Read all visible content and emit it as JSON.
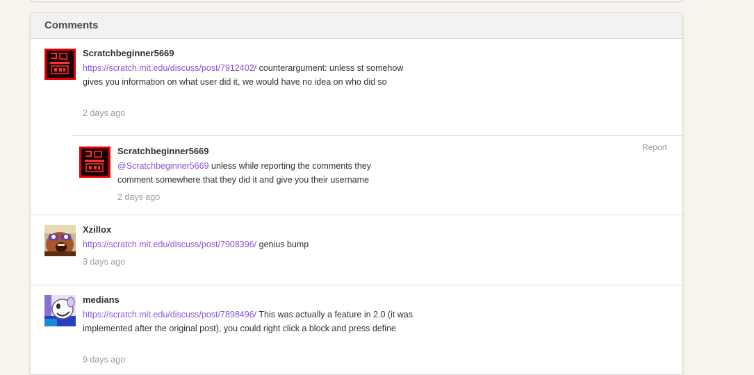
{
  "section": {
    "title": "Comments"
  },
  "comments": [
    {
      "username": "Scratchbeginner5669",
      "link": "https://scratch.mit.edu/discuss/post/7912402/",
      "text": " counterargument: unless st somehow gives you information on what user did it, we would have no idea on who did so",
      "time": "2 days ago",
      "avatar": "pixel-art-avatar",
      "reply": {
        "username": "Scratchbeginner5669",
        "mention": "@Scratchbeginner5669",
        "text": " unless while reporting the comments they comment somewhere that they did it and give you their username",
        "time": "2 days ago",
        "report_label": "Report",
        "avatar": "pixel-art-avatar"
      }
    },
    {
      "username": "Xzillox",
      "link": "https://scratch.mit.edu/discuss/post/7908396/",
      "text": " genius bump",
      "time": "3 days ago",
      "avatar": "cartoon-face-avatar"
    },
    {
      "username": "medians",
      "link": "https://scratch.mit.edu/discuss/post/7898496/",
      "text": " This was actually a feature in 2.0 (it was implemented after the original post), you could right click a block and press define",
      "time": "9 days ago",
      "avatar": "cartoon-creature-avatar"
    }
  ],
  "colors": {
    "link": "#8a55d7",
    "timestamp": "#9a9a9a",
    "page_background": "#f6f4ec"
  }
}
